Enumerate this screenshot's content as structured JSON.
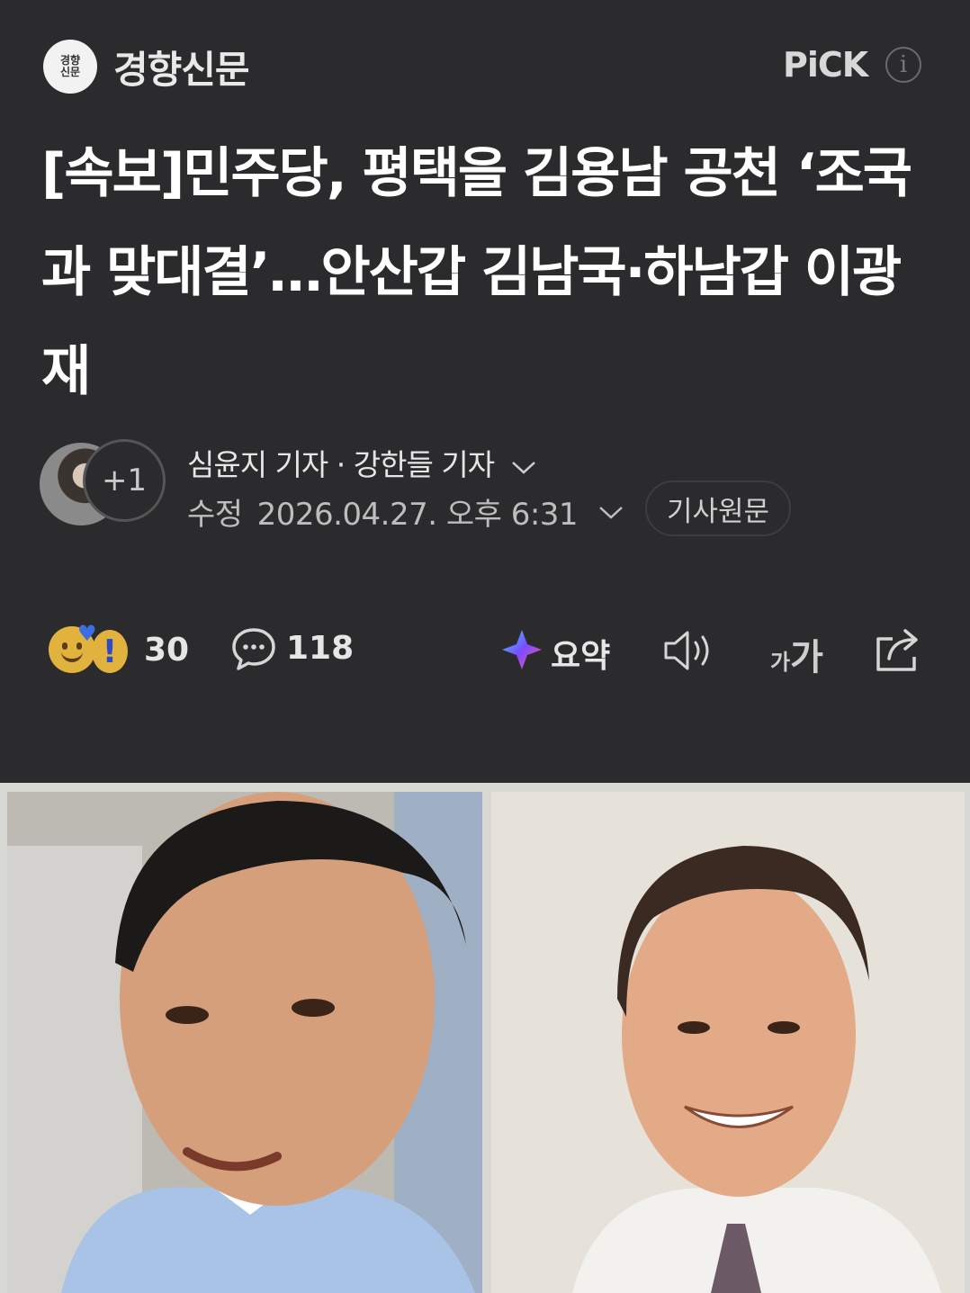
{
  "header": {
    "logo_text_line1": "경향",
    "logo_text_line2": "신문",
    "press_name": "경향신문",
    "pick_label": "PiCK",
    "info_icon": "info-icon"
  },
  "article": {
    "headline": "[속보]민주당, 평택을 김용남 공천 ‘조국과 맞대결’…안산갑 김남국·하남갑 이광재",
    "reporters": "심윤지 기자 · 강한들 기자",
    "more_reporters": "+1",
    "date_label": "수정",
    "date_value": "2026.04.27. 오후 6:31",
    "original_button": "기사원문"
  },
  "toolbar": {
    "reaction_count": "30",
    "comment_count": "118",
    "summary_label": "요약",
    "font_small": "가",
    "font_large": "가"
  },
  "colors": {
    "background": "#2b2b2d",
    "text": "#ffffff"
  }
}
